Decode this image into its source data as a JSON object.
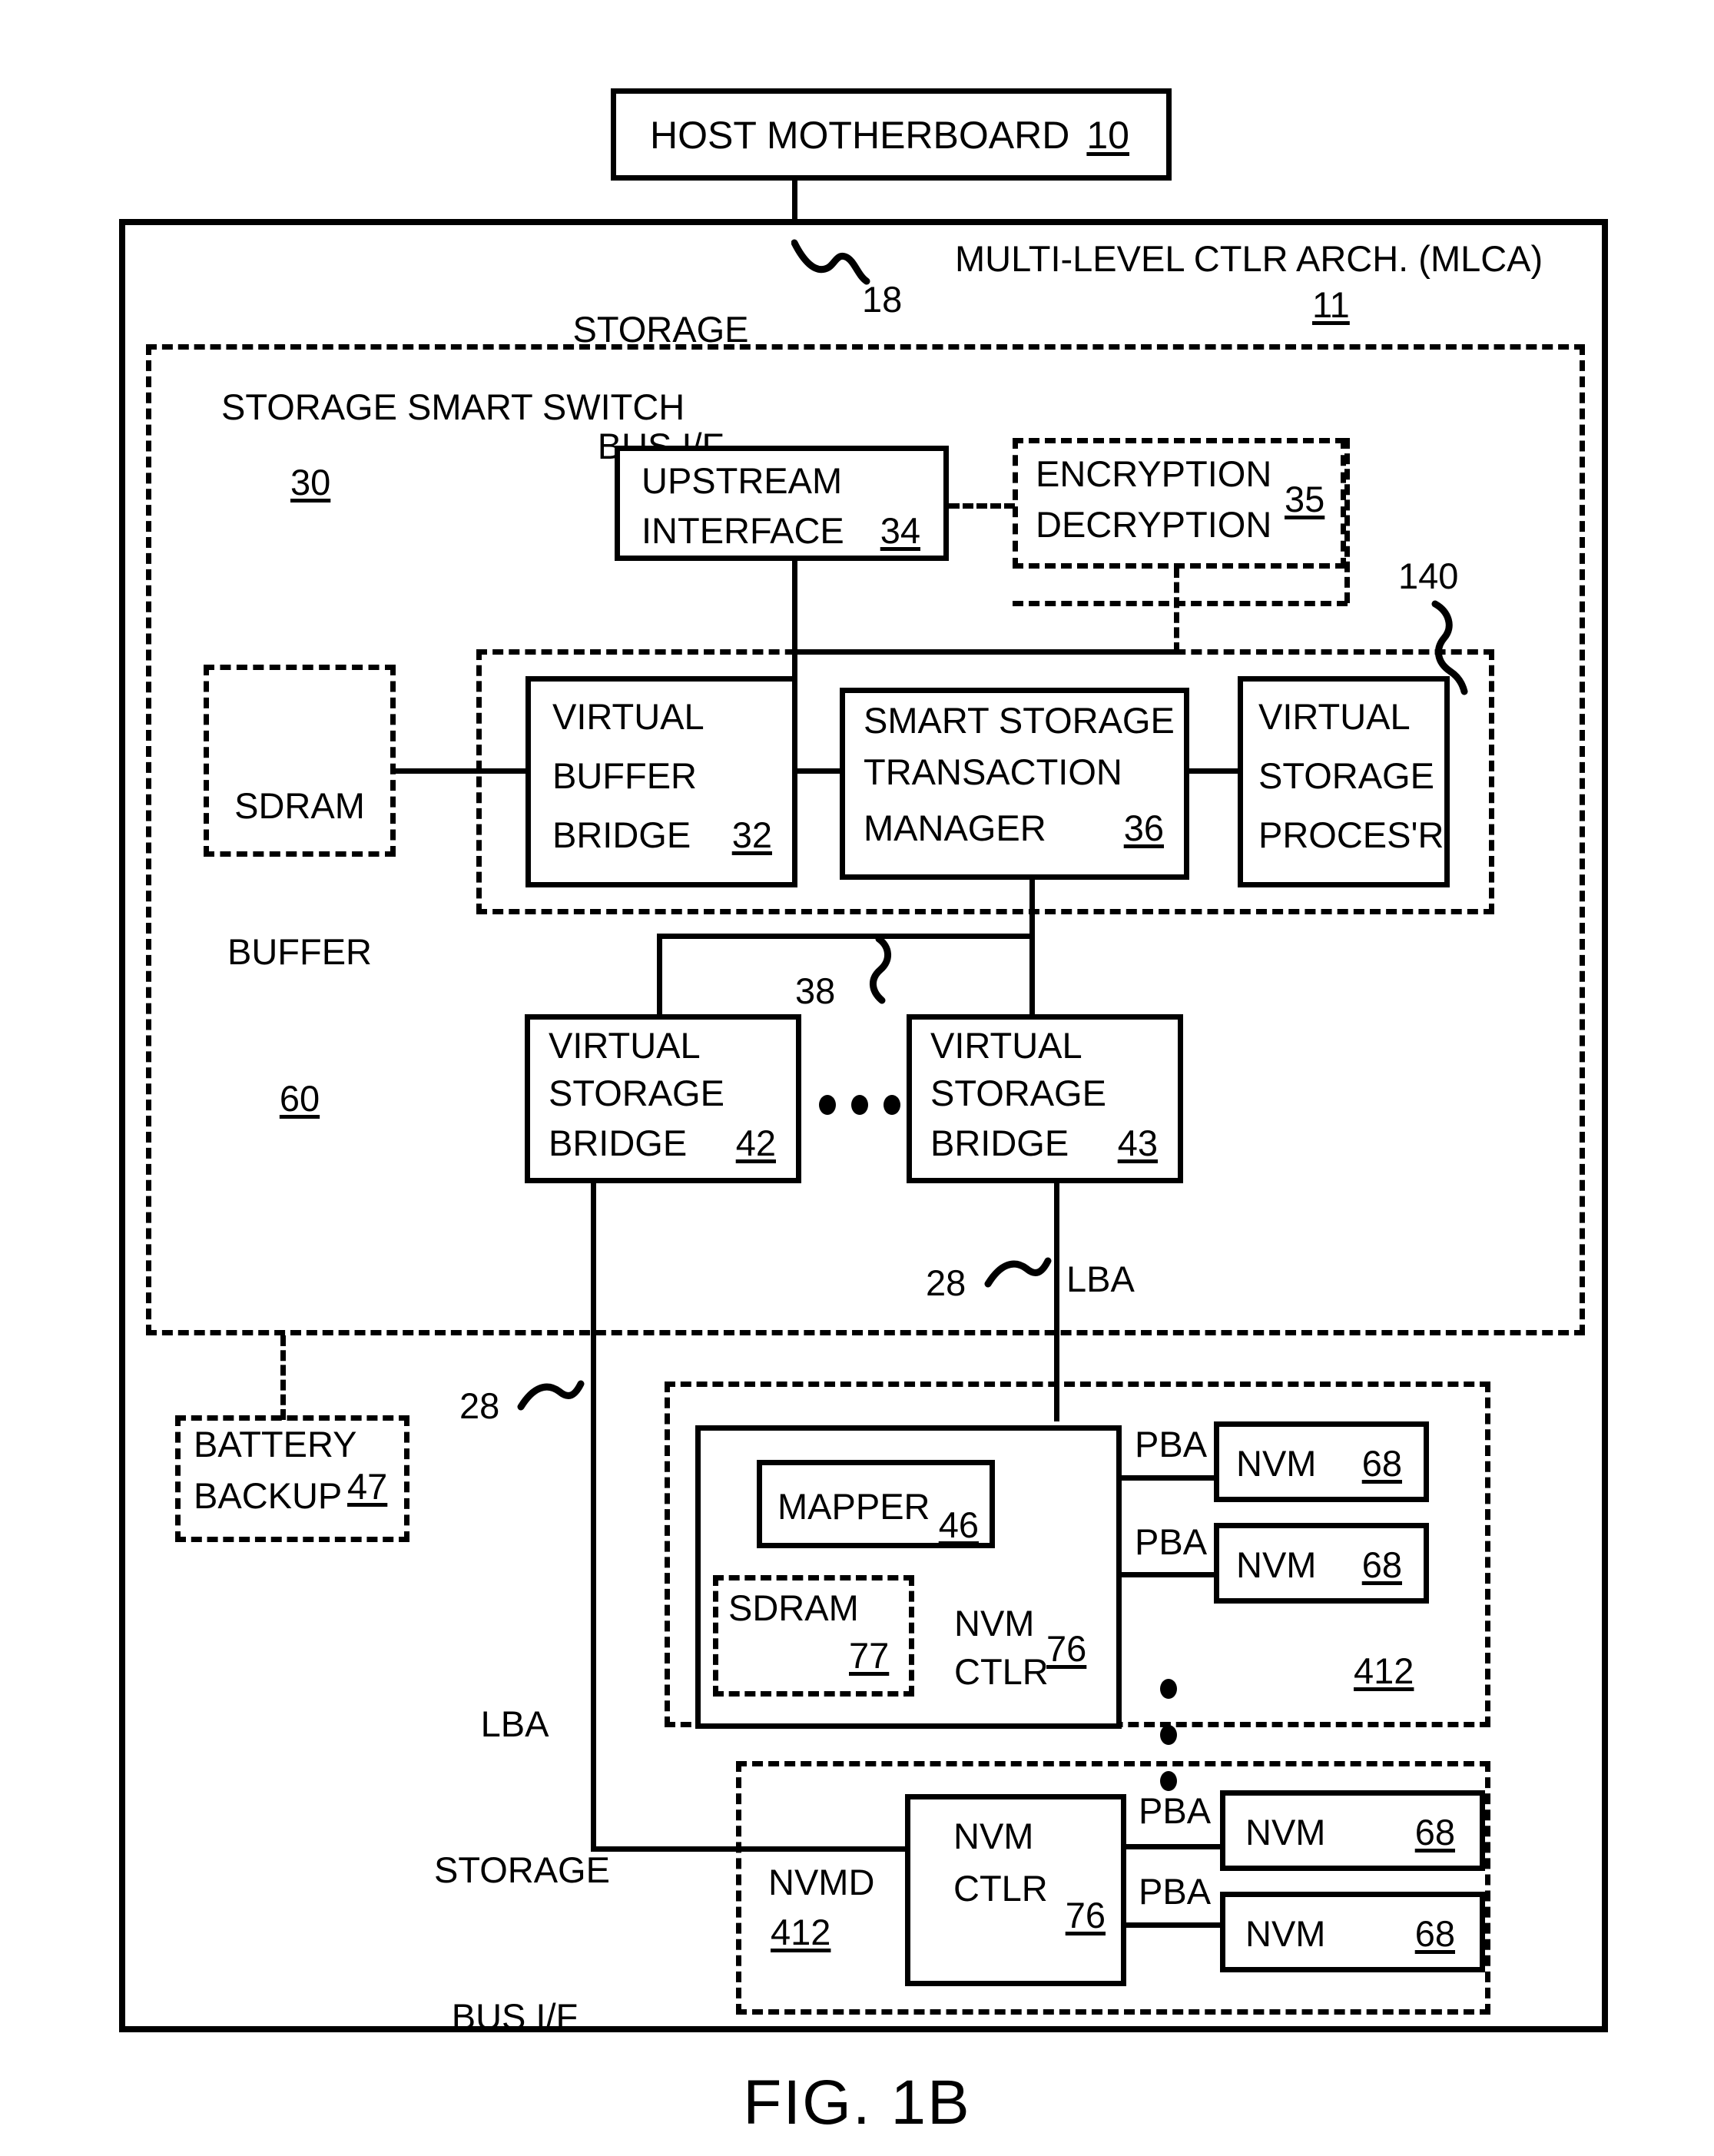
{
  "figure": {
    "caption": "FIG. 1B"
  },
  "host": {
    "label": "HOST MOTHERBOARD",
    "ref": "10"
  },
  "bus": {
    "storage_bus_if_line1": "STORAGE",
    "storage_bus_if_line2": "BUS I/F",
    "storage_bus_ref": "18"
  },
  "mlca": {
    "title": "MULTI-LEVEL CTLR ARCH. (MLCA)",
    "ref": "11"
  },
  "smart_switch": {
    "title": "STORAGE SMART SWITCH",
    "ref": "30"
  },
  "upstream_interface": {
    "line1": "UPSTREAM",
    "line2": "INTERFACE",
    "ref": "34"
  },
  "encryption": {
    "line1": "ENCRYPTION",
    "line2": "DECRYPTION",
    "ref": "35"
  },
  "group140": {
    "ref": "140"
  },
  "sdram_buffer": {
    "line1": "SDRAM",
    "line2": "BUFFER",
    "ref": "60"
  },
  "virtual_buffer_bridge": {
    "line1": "VIRTUAL",
    "line2": "BUFFER",
    "line3": "BRIDGE",
    "ref": "32"
  },
  "smart_storage_transaction_manager": {
    "line1": "SMART STORAGE",
    "line2": "TRANSACTION",
    "line3": "MANAGER",
    "ref": "36"
  },
  "virtual_storage_processor": {
    "line1": "VIRTUAL",
    "line2": "STORAGE",
    "line3": "PROCES'R"
  },
  "internal_bus": {
    "ref": "38"
  },
  "virtual_storage_bridge_42": {
    "line1": "VIRTUAL",
    "line2": "STORAGE",
    "line3": "BRIDGE",
    "ref": "42"
  },
  "virtual_storage_bridge_43": {
    "line1": "VIRTUAL",
    "line2": "STORAGE",
    "line3": "BRIDGE",
    "ref": "43"
  },
  "lba_link_right": {
    "ref": "28",
    "label": "LBA"
  },
  "lba_link_left": {
    "ref": "28"
  },
  "lba_storage_bus": {
    "line1": "LBA",
    "line2": "STORAGE",
    "line3": "BUS I/F"
  },
  "battery_backup": {
    "line1": "BATTERY",
    "line2": "BACKUP",
    "ref": "47"
  },
  "nvmd_top": {
    "ref": "412",
    "mapper": {
      "label": "MAPPER",
      "ref": "46"
    },
    "sdram": {
      "label": "SDRAM",
      "ref": "77"
    },
    "nvm_ctlr": {
      "line1": "NVM",
      "line2": "CTLR",
      "ref": "76"
    },
    "pba_top": "PBA",
    "pba_bottom": "PBA",
    "nvm_top": {
      "label": "NVM",
      "ref": "68"
    },
    "nvm_bottom": {
      "label": "NVM",
      "ref": "68"
    }
  },
  "nvmd_bottom": {
    "label": "NVMD",
    "ref": "412",
    "nvm_ctlr": {
      "line1": "NVM",
      "line2": "CTLR",
      "ref": "76"
    },
    "pba_top": "PBA",
    "pba_bottom": "PBA",
    "nvm_top": {
      "label": "NVM",
      "ref": "68"
    },
    "nvm_bottom": {
      "label": "NVM",
      "ref": "68"
    }
  },
  "colors": {
    "ink": "#000000",
    "paper": "#ffffff"
  }
}
